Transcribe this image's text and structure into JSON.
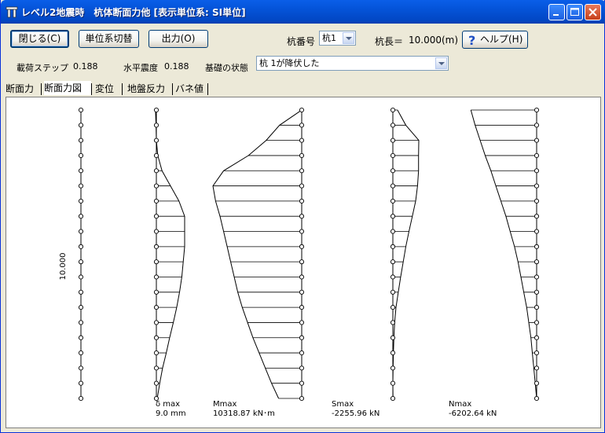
{
  "window": {
    "title": "レベル2地震時　杭体断面力他 [表示単位系: SI単位]"
  },
  "toolbar": {
    "close_label": "閉じる(C)",
    "units_label": "単位系切替",
    "output_label": "出力(O)",
    "pile_number_label": "杭番号",
    "pile_number_value": "杭1",
    "pile_length_label": "杭長＝",
    "pile_length_value": "10.000(m)",
    "help_label": "ヘルプ(H)"
  },
  "status": {
    "load_step_label": "載荷ステップ",
    "load_step_value": "0.188",
    "seismic_label": "水平震度",
    "seismic_value": "0.188",
    "foundation_label": "基礎の状態",
    "foundation_value": "杭 1が降伏した"
  },
  "tabs": [
    "断面力",
    "断面力図",
    "変位",
    "地盤反力",
    "バネ値"
  ],
  "active_tab": 1,
  "diagrams": {
    "length_label": "10.000",
    "panels": [
      {
        "title": "δ max",
        "value": "9.0 mm"
      },
      {
        "title": "Mmax",
        "value": "10318.87 kN･m"
      },
      {
        "title": "Smax",
        "value": "-2255.96 kN"
      },
      {
        "title": "Nmax",
        "value": "-6202.64 kN"
      }
    ]
  },
  "chart_data": {
    "type": "line",
    "node_count": 20,
    "series": [
      {
        "name": "δ max",
        "values": [
          -0.03,
          -0.01,
          0,
          0.05,
          0.2,
          0.5,
          0.8,
          1,
          1,
          1,
          0.95,
          0.9,
          0.82,
          0.72,
          0.6,
          0.47,
          0.35,
          0.22,
          0.12,
          0.03
        ]
      },
      {
        "name": "Mmax",
        "values": [
          0,
          0.25,
          0.4,
          0.6,
          0.88,
          1,
          0.97,
          0.92,
          0.88,
          0.84,
          0.8,
          0.76,
          0.72,
          0.67,
          0.61,
          0.55,
          0.48,
          0.41,
          0.34,
          0.26
        ]
      },
      {
        "name": "Smax",
        "values": [
          0.18,
          0.5,
          1,
          0.99,
          0.99,
          0.95,
          0.88,
          0.75,
          0.62,
          0.5,
          0.4,
          0.3,
          0.21,
          0.12,
          0.07,
          0.04,
          0.02,
          0.01,
          0,
          0.005
        ]
      },
      {
        "name": "Nmax",
        "values": [
          0.92,
          0.86,
          0.79,
          0.72,
          0.64,
          0.57,
          0.5,
          0.43,
          0.37,
          0.31,
          0.26,
          0.22,
          0.18,
          0.14,
          0.11,
          0.08,
          0.06,
          0.04,
          0.02,
          0
        ]
      }
    ]
  }
}
